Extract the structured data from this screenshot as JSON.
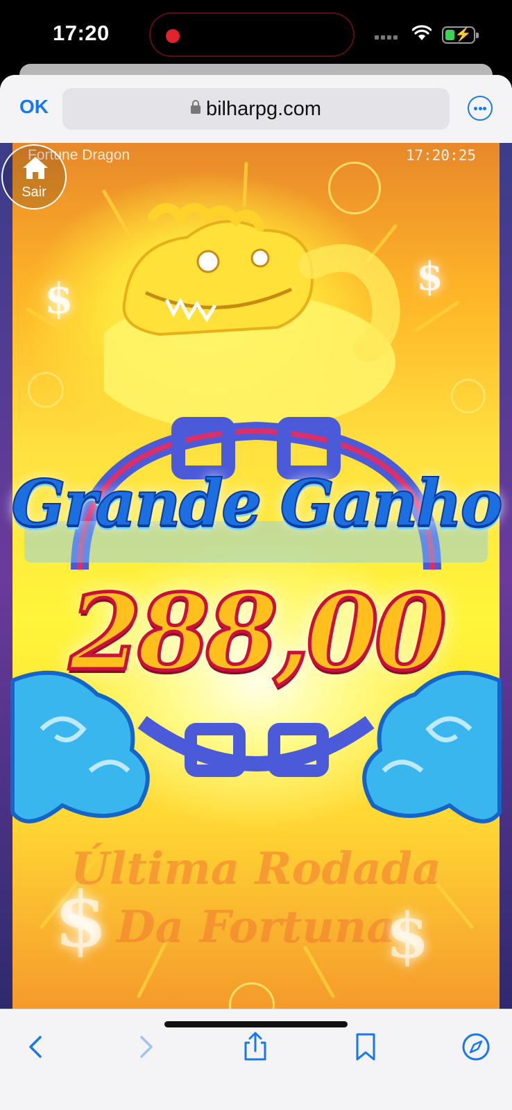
{
  "status_bar": {
    "time": "17:20",
    "recording": true,
    "wifi_icon": "wifi-icon",
    "battery_charging": true
  },
  "browser": {
    "done_label": "OK",
    "url": "bilharpg.com",
    "more_icon": "ellipsis-circle-icon",
    "accent_color": "#1677ee"
  },
  "game": {
    "title": "Fortune Dragon",
    "clock": "17:20:25",
    "exit_label": "Sair",
    "big_win_text": "Grande Ganho",
    "win_amount": "288,00",
    "last_round_line1": "Última Rodada",
    "last_round_line2": "Da Fortuna"
  },
  "toolbar": {
    "items": [
      "back-icon",
      "forward-icon",
      "share-icon",
      "bookmarks-icon",
      "compass-icon"
    ]
  }
}
